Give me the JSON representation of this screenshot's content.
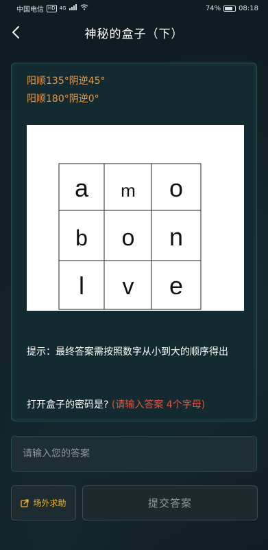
{
  "status_bar": {
    "carrier": "中国电信",
    "hd": "HD",
    "network": "4G",
    "battery": "74%",
    "battery_level": 0.74,
    "time": "08:18"
  },
  "header": {
    "title": "神秘的盒子（下）"
  },
  "puzzle": {
    "clue_line_1": "阳顺135°阴逆45°",
    "clue_line_2": "阳顺180°阴逆0°",
    "grid": [
      [
        "a",
        "m",
        "o"
      ],
      [
        "b",
        "o",
        "n"
      ],
      [
        "l",
        "v",
        "e"
      ]
    ],
    "hint": "提示：最终答案需按照数字从小到大的顺序得出",
    "question": "打开盒子的密码是?",
    "question_note": "(请输入答案 4个字母)"
  },
  "answer": {
    "placeholder": "请输入您的答案",
    "value": ""
  },
  "buttons": {
    "help_label": "场外求助",
    "submit_label": "提交答案"
  },
  "colors": {
    "background": "#0f1d22",
    "clue_orange": "#e79a45",
    "note_red": "#e0563f",
    "help_gold": "#f0b030"
  }
}
